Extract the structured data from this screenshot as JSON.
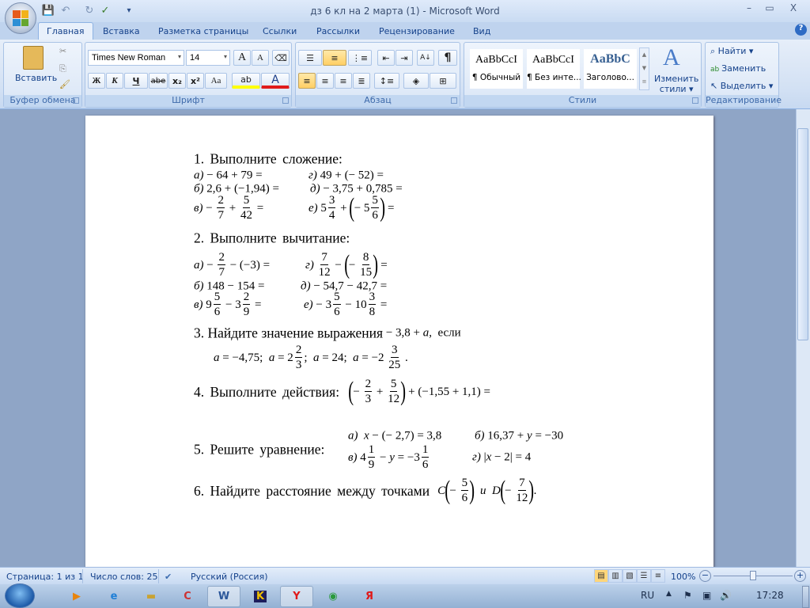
{
  "window": {
    "title": "дз 6 кл на 2 марта (1) - Microsoft Word",
    "minimize": "–",
    "maximize": "▭",
    "close": "X"
  },
  "quick_access": {
    "save": "💾",
    "undo": "↶",
    "redo": "↻",
    "spell": "✓",
    "customize": "▾"
  },
  "tabs": [
    "Главная",
    "Вставка",
    "Разметка страницы",
    "Ссылки",
    "Рассылки",
    "Рецензирование",
    "Вид"
  ],
  "ribbon": {
    "clipboard": {
      "label": "Буфер обмена",
      "paste": "Вставить"
    },
    "font": {
      "label": "Шрифт",
      "family": "Times New Roman",
      "size": "14",
      "bold": "Ж",
      "italic": "К",
      "underline": "Ч",
      "strike": "abe",
      "sub": "x₂",
      "sup": "x²",
      "case": "Aa",
      "grow": "A",
      "shrink": "A",
      "highlight": "ab",
      "color": "A"
    },
    "paragraph": {
      "label": "Абзац",
      "pilcrow": "¶",
      "sort": "A↓"
    },
    "styles": {
      "label": "Стили",
      "items": [
        {
          "sample": "AaBbCcI",
          "name": "¶ Обычный"
        },
        {
          "sample": "AaBbCcI",
          "name": "¶ Без инте..."
        },
        {
          "sample": "AaBbC",
          "name": "Заголово..."
        }
      ],
      "change_line1": "Изменить",
      "change_line2": "стили ▾"
    },
    "editing": {
      "label": "Редактирование",
      "find": "Найти ▾",
      "replace": "Заменить",
      "select": "Выделить ▾"
    }
  },
  "document": {
    "p1_title": "1.  Выполните  сложение:",
    "p2_title": "2.  Выполните  вычитание:",
    "p3_title": "3.  Найдите значение выражения",
    "p4_title": "4.  Выполните  действия:",
    "p5_title": "5.  Решите  уравнение:",
    "p6_title": "6.  Найдите  расстояние  между  точками",
    "exprs": {
      "p1a": [
        {
          "i": "а) "
        },
        "− 64 + 79 ="
      ],
      "p1g": [
        {
          "i": "г) "
        },
        "49 + (− 52) ="
      ],
      "p1b": [
        {
          "i": "б) "
        },
        "2,6 + (−1,94) ="
      ],
      "p1d": [
        {
          "i": "д) "
        },
        "− 3,75 + 0,785 ="
      ],
      "p1v": [
        {
          "i": "в) "
        },
        "− ",
        {
          "f": [
            "2",
            "7"
          ]
        },
        " + ",
        {
          "f": [
            "5",
            "42"
          ]
        },
        " ="
      ],
      "p1e": [
        {
          "i": "е) "
        },
        "5",
        {
          "f": [
            "3",
            "4"
          ]
        },
        " + ",
        {
          "p": "("
        },
        "− 5",
        {
          "f": [
            "5",
            "6"
          ]
        },
        {
          "p": ")"
        },
        " ="
      ],
      "p2a": [
        {
          "i": "а) "
        },
        "− ",
        {
          "f": [
            "2",
            "7"
          ]
        },
        " − (−3) ="
      ],
      "p2g": [
        {
          "i": "г) "
        },
        {
          "f": [
            "7",
            "12"
          ]
        },
        " − ",
        {
          "p": "("
        },
        "− ",
        {
          "f": [
            "8",
            "15"
          ]
        },
        {
          "p": ")"
        },
        " ="
      ],
      "p2b": [
        {
          "i": "б) "
        },
        "148 − 154 ="
      ],
      "p2d": [
        {
          "i": "д) "
        },
        "− 54,7 − 42,7 ="
      ],
      "p2v": [
        {
          "i": "в) "
        },
        "9",
        {
          "f": [
            "5",
            "6"
          ]
        },
        " − 3",
        {
          "f": [
            "2",
            "9"
          ]
        },
        " ="
      ],
      "p2e": [
        {
          "i": "е) "
        },
        "− 3",
        {
          "f": [
            "5",
            "6"
          ]
        },
        " − 10",
        {
          "f": [
            "3",
            "8"
          ]
        },
        " ="
      ],
      "p3expr": [
        " − 3,8 + ",
        {
          "i": "a"
        },
        ",  если"
      ],
      "p3vals": [
        {
          "i": "a"
        },
        " = −4,75;  ",
        {
          "i": "a"
        },
        " = 2",
        {
          "f": [
            "2",
            "3"
          ]
        },
        ";  ",
        {
          "i": "a"
        },
        " = 24;  ",
        {
          "i": "a"
        },
        " = −2 ",
        {
          "f": [
            "3",
            "25"
          ]
        },
        " ."
      ],
      "p4expr": [
        {
          "p": "("
        },
        "− ",
        {
          "f": [
            "2",
            "3"
          ]
        },
        " + ",
        {
          "f": [
            "5",
            "12"
          ]
        },
        {
          "p": ")"
        },
        " + (−1,55 + 1,1) ="
      ],
      "p5a": [
        {
          "i": "а)  x"
        },
        " − (− 2,7) = 3,8"
      ],
      "p5b": [
        {
          "i": "б) "
        },
        "16,37 + ",
        {
          "i": "y"
        },
        " = −30"
      ],
      "p5v": [
        {
          "i": "в) "
        },
        "4",
        {
          "f": [
            "1",
            "9"
          ]
        },
        " − ",
        {
          "i": "y"
        },
        " = −3",
        {
          "f": [
            "1",
            "6"
          ]
        }
      ],
      "p5g": [
        {
          "i": "г) "
        },
        "|",
        {
          "i": "x"
        },
        " − 2| = 4"
      ],
      "p6expr": [
        {
          "i": "C"
        },
        {
          "p": "("
        },
        "− ",
        {
          "f": [
            "5",
            "6"
          ]
        },
        {
          "p": ")"
        },
        {
          "i": "  и  D"
        },
        {
          "p": "("
        },
        "− ",
        {
          "f": [
            "7",
            "12"
          ]
        },
        {
          "p": ")"
        },
        "."
      ]
    }
  },
  "status": {
    "page": "Страница: 1 из 1",
    "words": "Число слов: 25",
    "language": "Русский (Россия)",
    "zoom": "100%",
    "zoom_value_percent": 100
  },
  "taskbar": {
    "items": [
      "media-player",
      "internet-explorer",
      "explorer",
      "ccleaner",
      "word",
      "k-app",
      "yandex-browser",
      "chrome",
      "yandex"
    ],
    "lang": "RU",
    "clock": "17:28"
  }
}
